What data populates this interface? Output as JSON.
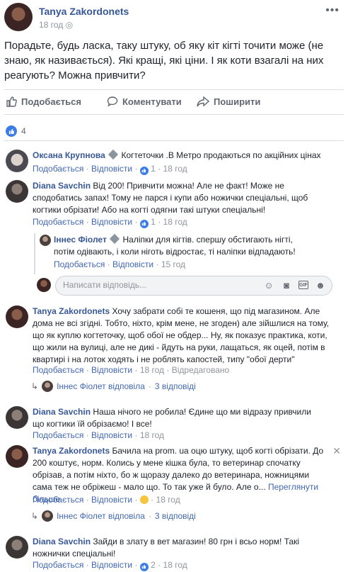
{
  "post": {
    "author": "Tanya Zakordonets",
    "time": "18 год",
    "text": "Порадьте, будь ласка, таку штуку, об яку кіт кігті точити може (не знаю, як називається). Які кращі, які ціни. І як коти взагалі на них реагують? Можна привчити?",
    "menu": "•••"
  },
  "actions": {
    "like": "Подобається",
    "comment": "Коментувати",
    "share": "Поширити"
  },
  "reactions": {
    "count": "4"
  },
  "comments": [
    {
      "author": "Оксана Крупнова",
      "badge": true,
      "text": "Когтеточки .В Метро продаються по акційних цінах",
      "like": "Подобається",
      "reply": "Відповісти",
      "likes": "1",
      "time": "18 год"
    },
    {
      "author": "Diana Savchin",
      "text": "Від 200! Привчити можна! Але не факт! Може не сподобатись запах! Тому не парся і купи або ножички спеціальні, щоб когтики обрізати! Або на когті одягни такі штуки спеціальні!",
      "like": "Подобається",
      "reply": "Відповісти",
      "likes": "1",
      "time": "18 год"
    },
    {
      "author": "Іннес Фіолет",
      "badge": true,
      "text": "Наліпки для кігтів. спершу обстигають нігті, потім одівають, і коли ніготь відростає, ті наліпки відпадають!",
      "like": "Подобається",
      "reply": "Відповісти",
      "time": "15 год"
    },
    {
      "author": "Tanya Zakordonets",
      "text": "Хочу забрати собі те кошеня, що під магазином. Але дома не всі згідні. Тобто, ніхто, крім мене, не згоден) але зійшлися на тому, що як куплю когтеточку, щоб обої не обдер... Ну, як показує практика, коти, що жили на вулиці, але не дикі - йдуть на руки, лащаться, як оцей, потім в квартирі і на лоток ходять і не роблять капостей, типу \"обої дерти\"",
      "like": "Подобається",
      "reply": "Відповісти",
      "time": "18 год",
      "edited": "Відредаговано"
    },
    {
      "author": "Diana Savchin",
      "text": "Наша нічого не робила! Єдине що ми відразу привчили що когтики їй обрізаємо! І все!",
      "like": "Подобається",
      "reply": "Відповісти",
      "time": "18 год"
    },
    {
      "author": "Tanya Zakordonets",
      "text": "Бачила на prom. ua оцю штуку, щоб когті обрізати. До 200 коштує, норм. Колись у мене кішка була, то ветеринар спочатку обрізав, а потім ніхто, бо ж щоразу далеко до ветеринара, ножницями сама теж не обріжеш - мало що. То так уже й було. Але о...",
      "seemore": "Переглянути більше",
      "like": "Подобається",
      "reply": "Відповісти",
      "time": "18 год"
    },
    {
      "author": "Diana Savchin",
      "text": "Зайди в злату в вет магазин! 80 грн і всьо норм! Такі ножнички спеціальні!",
      "like": "Подобається",
      "reply": "Відповісти",
      "likes": "2",
      "time": "18 год"
    }
  ],
  "reply_input": {
    "placeholder": "Написати відповідь..."
  },
  "replies_links": [
    {
      "text": "Іннес Фіолет відповіла",
      "count": "3 відповіді"
    },
    {
      "text": "Іннес Фіолет відповіла",
      "count": "3 відповіді"
    }
  ],
  "sep": "·",
  "colors": {
    "link": "#385898",
    "meta": "#90949c",
    "like": "#3b7ce6"
  }
}
